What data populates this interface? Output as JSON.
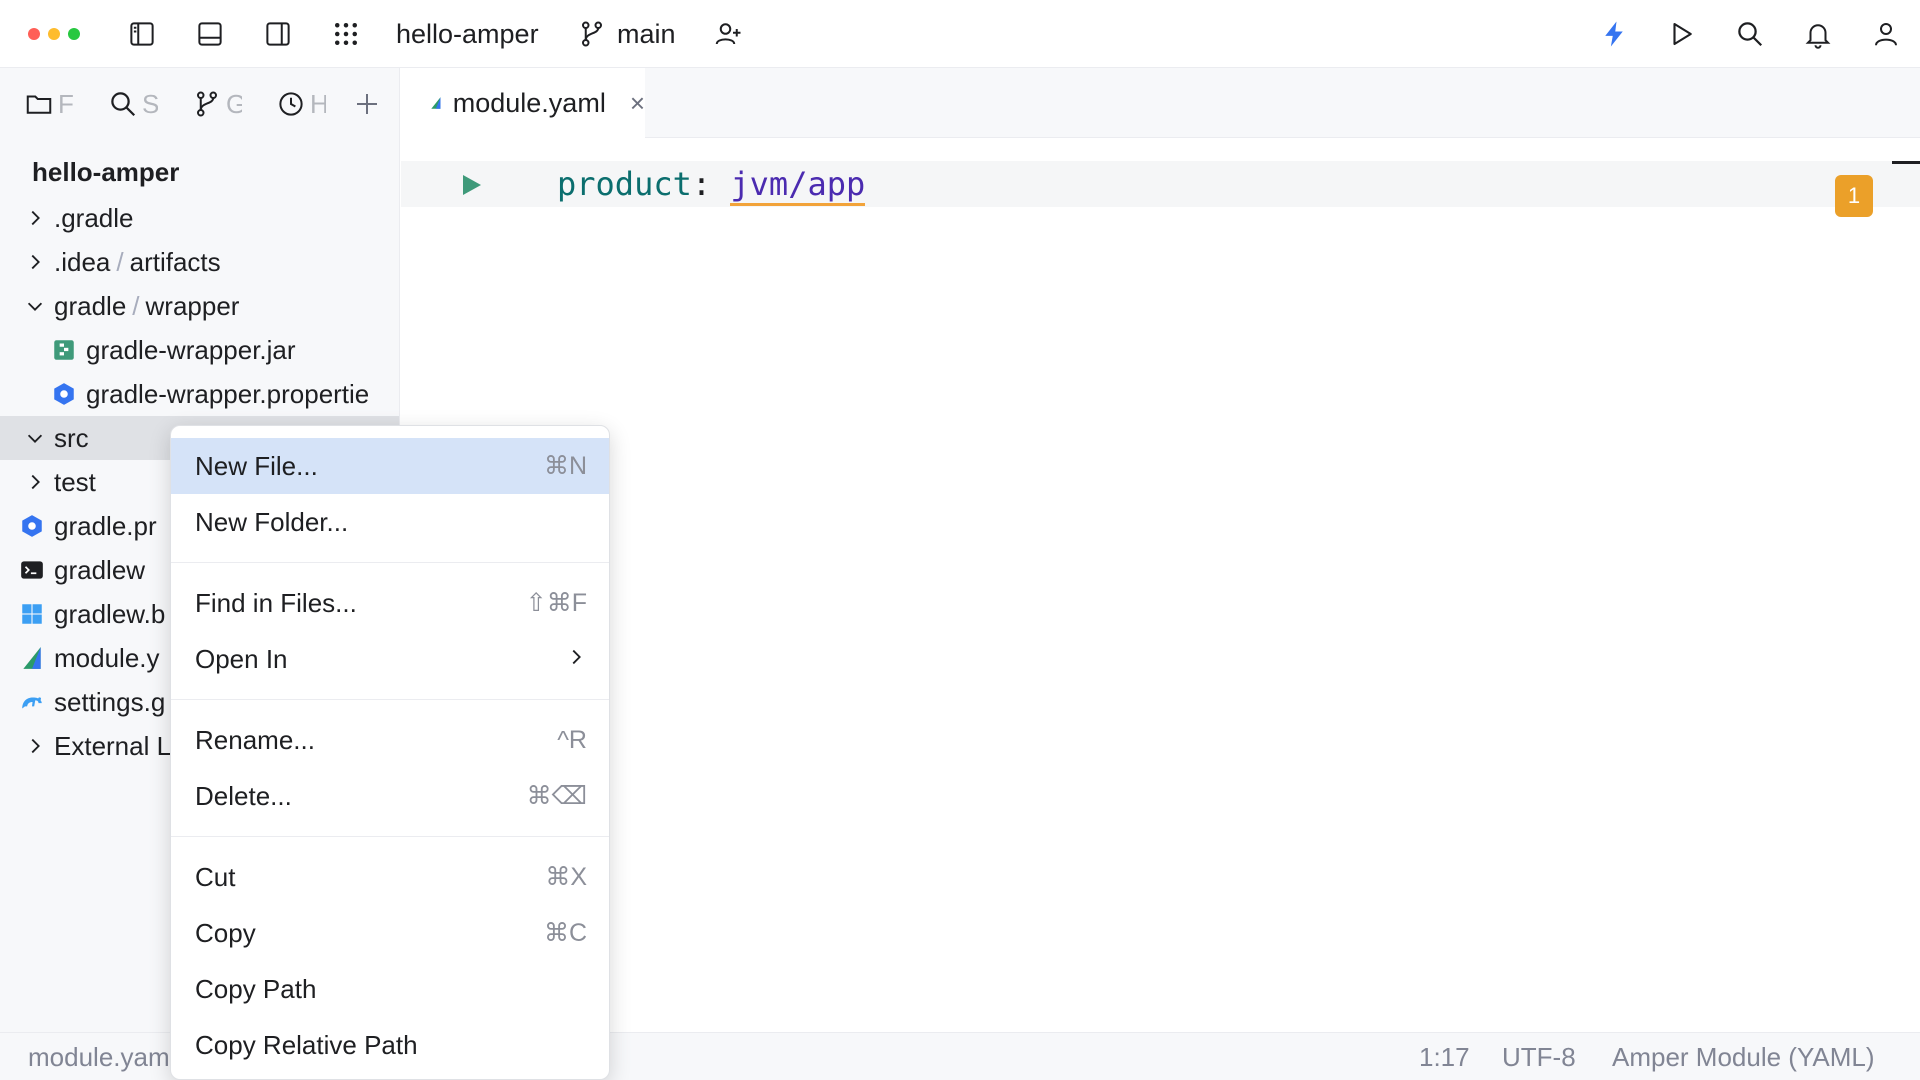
{
  "colors": {
    "accent": "#3574f0",
    "warning": "#eba029",
    "run_green": "#3f9a7a",
    "menu_highlight": "#d5e3f8"
  },
  "titlebar": {
    "project": "hello-amper",
    "branch": "main",
    "left_icons": [
      "left-sidebar-toggle-icon",
      "bottom-panel-toggle-icon",
      "right-sidebar-toggle-icon",
      "main-menu-grid-icon"
    ],
    "right_icons": [
      "ai-assistant-bolt-icon",
      "run-icon",
      "search-icon",
      "notifications-bell-icon",
      "account-icon"
    ]
  },
  "tool_tabs": [
    {
      "label": "F",
      "icon": "folder-icon"
    },
    {
      "label": "S",
      "icon": "search-icon"
    },
    {
      "label": "G",
      "icon": "git-branch-icon"
    },
    {
      "label": "H",
      "icon": "history-icon"
    }
  ],
  "tree": {
    "title": "hello-amper",
    "items": [
      {
        "label": ".gradle",
        "chevron": "right"
      },
      {
        "label": ".idea",
        "sub": "artifacts",
        "chevron": "right"
      },
      {
        "label": "gradle",
        "sub": "wrapper",
        "chevron": "down"
      },
      {
        "label": "gradle-wrapper.jar",
        "icon": "jar-file-icon"
      },
      {
        "label": "gradle-wrapper.propertie",
        "icon": "properties-file-icon"
      },
      {
        "label": "src",
        "chevron": "down"
      },
      {
        "label": "test",
        "chevron": "right"
      },
      {
        "label": "gradle.pr",
        "icon": "properties-file-icon"
      },
      {
        "label": "gradlew",
        "icon": "terminal-script-icon"
      },
      {
        "label": "gradlew.b",
        "icon": "windows-batch-icon"
      },
      {
        "label": "module.y",
        "icon": "amper-module-icon"
      },
      {
        "label": "settings.g",
        "icon": "gradle-elephant-icon"
      },
      {
        "label": "External L",
        "chevron": "right"
      }
    ]
  },
  "editor": {
    "tab_label": "module.yaml",
    "close_glyph": "×",
    "code_key": "product",
    "code_colon": ": ",
    "code_value": "jvm/app",
    "warning_count": "1"
  },
  "context_menu": {
    "items": [
      {
        "label": "New File...",
        "shortcut": "⌘N"
      },
      {
        "label": "New Folder...",
        "shortcut": ""
      },
      {
        "label": "Find in Files...",
        "shortcut": "⇧⌘F"
      },
      {
        "label": "Open In",
        "shortcut": ""
      },
      {
        "label": "Rename...",
        "shortcut": "^R"
      },
      {
        "label": "Delete...",
        "shortcut": "⌘⌫"
      },
      {
        "label": "Cut",
        "shortcut": "⌘X"
      },
      {
        "label": "Copy",
        "shortcut": "⌘C"
      },
      {
        "label": "Copy Path",
        "shortcut": ""
      },
      {
        "label": "Copy Relative Path",
        "shortcut": ""
      }
    ]
  },
  "statusbar": {
    "file": "module.yam",
    "position": "1:17",
    "encoding": "UTF-8",
    "filetype": "Amper Module (YAML)"
  }
}
